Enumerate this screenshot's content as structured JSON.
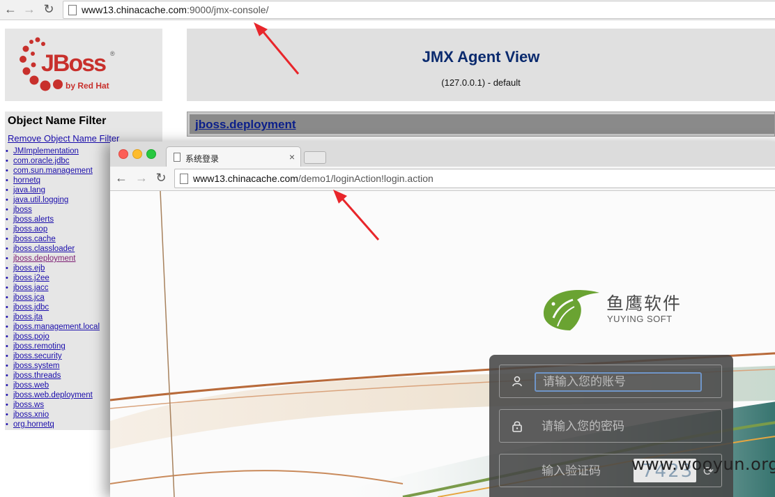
{
  "back_browser": {
    "url_host": "www13.chinacache.com",
    "url_path": ":9000/jmx-console/"
  },
  "jboss_logo": {
    "main": "JBoss",
    "registered": "®",
    "tagline": "by Red Hat"
  },
  "jmx_header": {
    "title": "JMX Agent View",
    "subtitle": "(127.0.0.1) - default"
  },
  "filter_panel": {
    "title": "Object Name Filter",
    "remove_link": "Remove Object Name Filter",
    "domains": [
      "JMImplementation",
      "com.oracle.jdbc",
      "com.sun.management",
      "hornetq",
      "java.lang",
      "java.util.logging",
      "jboss",
      "jboss.alerts",
      "jboss.aop",
      "jboss.cache",
      "jboss.classloader",
      "jboss.deployment",
      "jboss.ejb",
      "jboss.j2ee",
      "jboss.jacc",
      "jboss.jca",
      "jboss.jdbc",
      "jboss.jta",
      "jboss.management.local",
      "jboss.pojo",
      "jboss.remoting",
      "jboss.security",
      "jboss.system",
      "jboss.threads",
      "jboss.web",
      "jboss.web.deployment",
      "jboss.ws",
      "jboss.xnio",
      "org.hornetq"
    ],
    "visited_domain": "jboss.deployment"
  },
  "deployment_section": {
    "title": "jboss.deployment"
  },
  "front_browser": {
    "tab_title": "系统登录",
    "url_host": "www13.chinacache.com",
    "url_path": "/demo1/loginAction!login.action"
  },
  "brand": {
    "name_cn": "鱼鹰软件",
    "name_en": "YUYING SOFT",
    "accent_color": "#6aa332"
  },
  "login": {
    "username_placeholder": "请输入您的账号",
    "password_placeholder": "请输入您的密码",
    "captcha_placeholder": "输入验证码",
    "captcha_text": "7423"
  },
  "watermark": "www.wooyun.org",
  "colors": {
    "jboss_red": "#c8302c",
    "link_blue": "#1a0dab",
    "title_navy": "#0a2a6e",
    "arrow_red": "#e8262b"
  },
  "icons": {
    "user": "user-icon",
    "lock": "lock-icon",
    "refresh": "refresh-icon"
  }
}
